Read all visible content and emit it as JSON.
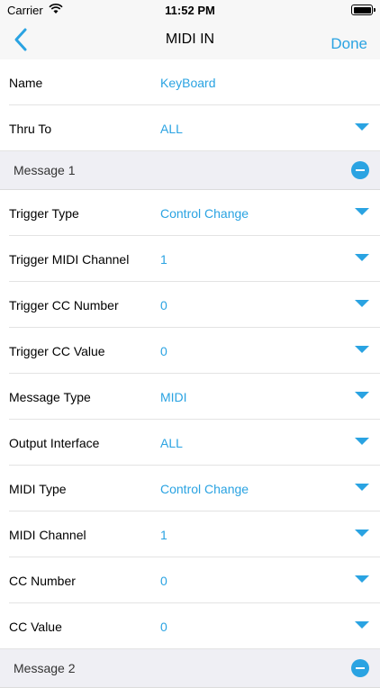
{
  "status": {
    "carrier": "Carrier",
    "time": "11:52 PM"
  },
  "nav": {
    "title": "MIDI IN",
    "done_label": "Done"
  },
  "header_rows": [
    {
      "label": "Name",
      "value": "KeyBoard",
      "has_dropdown": false
    },
    {
      "label": "Thru To",
      "value": "ALL",
      "has_dropdown": true
    }
  ],
  "sections": [
    {
      "title": "Message 1",
      "rows": [
        {
          "label": "Trigger Type",
          "value": "Control Change"
        },
        {
          "label": "Trigger MIDI Channel",
          "value": "1"
        },
        {
          "label": "Trigger CC Number",
          "value": "0"
        },
        {
          "label": "Trigger CC Value",
          "value": "0"
        },
        {
          "label": "Message Type",
          "value": "MIDI"
        },
        {
          "label": "Output Interface",
          "value": "ALL"
        },
        {
          "label": "MIDI Type",
          "value": "Control Change"
        },
        {
          "label": "MIDI Channel",
          "value": "1"
        },
        {
          "label": "CC Number",
          "value": "0"
        },
        {
          "label": "CC Value",
          "value": "0"
        }
      ]
    },
    {
      "title": "Message 2",
      "rows": []
    }
  ],
  "colors": {
    "accent": "#2aa3e2",
    "section_bg": "#efeff4",
    "nav_bg": "#f7f7f7"
  }
}
